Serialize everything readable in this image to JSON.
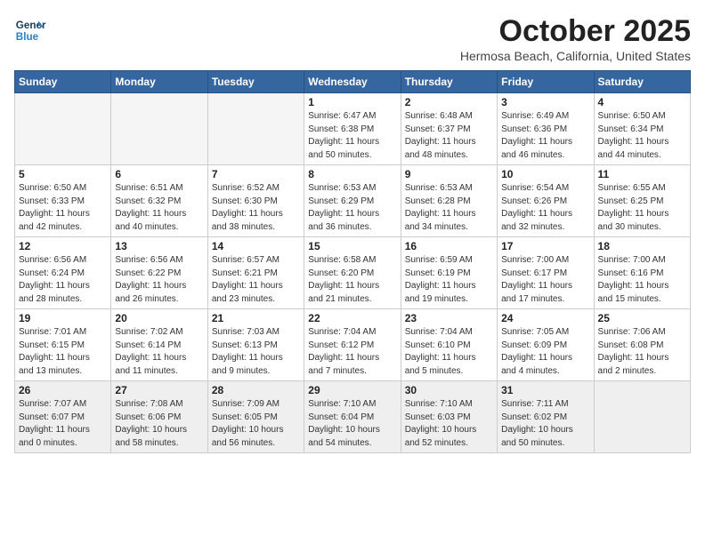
{
  "logo": {
    "line1": "General",
    "line2": "Blue"
  },
  "title": "October 2025",
  "location": "Hermosa Beach, California, United States",
  "weekdays": [
    "Sunday",
    "Monday",
    "Tuesday",
    "Wednesday",
    "Thursday",
    "Friday",
    "Saturday"
  ],
  "weeks": [
    [
      {
        "day": "",
        "info": ""
      },
      {
        "day": "",
        "info": ""
      },
      {
        "day": "",
        "info": ""
      },
      {
        "day": "1",
        "info": "Sunrise: 6:47 AM\nSunset: 6:38 PM\nDaylight: 11 hours\nand 50 minutes."
      },
      {
        "day": "2",
        "info": "Sunrise: 6:48 AM\nSunset: 6:37 PM\nDaylight: 11 hours\nand 48 minutes."
      },
      {
        "day": "3",
        "info": "Sunrise: 6:49 AM\nSunset: 6:36 PM\nDaylight: 11 hours\nand 46 minutes."
      },
      {
        "day": "4",
        "info": "Sunrise: 6:50 AM\nSunset: 6:34 PM\nDaylight: 11 hours\nand 44 minutes."
      }
    ],
    [
      {
        "day": "5",
        "info": "Sunrise: 6:50 AM\nSunset: 6:33 PM\nDaylight: 11 hours\nand 42 minutes."
      },
      {
        "day": "6",
        "info": "Sunrise: 6:51 AM\nSunset: 6:32 PM\nDaylight: 11 hours\nand 40 minutes."
      },
      {
        "day": "7",
        "info": "Sunrise: 6:52 AM\nSunset: 6:30 PM\nDaylight: 11 hours\nand 38 minutes."
      },
      {
        "day": "8",
        "info": "Sunrise: 6:53 AM\nSunset: 6:29 PM\nDaylight: 11 hours\nand 36 minutes."
      },
      {
        "day": "9",
        "info": "Sunrise: 6:53 AM\nSunset: 6:28 PM\nDaylight: 11 hours\nand 34 minutes."
      },
      {
        "day": "10",
        "info": "Sunrise: 6:54 AM\nSunset: 6:26 PM\nDaylight: 11 hours\nand 32 minutes."
      },
      {
        "day": "11",
        "info": "Sunrise: 6:55 AM\nSunset: 6:25 PM\nDaylight: 11 hours\nand 30 minutes."
      }
    ],
    [
      {
        "day": "12",
        "info": "Sunrise: 6:56 AM\nSunset: 6:24 PM\nDaylight: 11 hours\nand 28 minutes."
      },
      {
        "day": "13",
        "info": "Sunrise: 6:56 AM\nSunset: 6:22 PM\nDaylight: 11 hours\nand 26 minutes."
      },
      {
        "day": "14",
        "info": "Sunrise: 6:57 AM\nSunset: 6:21 PM\nDaylight: 11 hours\nand 23 minutes."
      },
      {
        "day": "15",
        "info": "Sunrise: 6:58 AM\nSunset: 6:20 PM\nDaylight: 11 hours\nand 21 minutes."
      },
      {
        "day": "16",
        "info": "Sunrise: 6:59 AM\nSunset: 6:19 PM\nDaylight: 11 hours\nand 19 minutes."
      },
      {
        "day": "17",
        "info": "Sunrise: 7:00 AM\nSunset: 6:17 PM\nDaylight: 11 hours\nand 17 minutes."
      },
      {
        "day": "18",
        "info": "Sunrise: 7:00 AM\nSunset: 6:16 PM\nDaylight: 11 hours\nand 15 minutes."
      }
    ],
    [
      {
        "day": "19",
        "info": "Sunrise: 7:01 AM\nSunset: 6:15 PM\nDaylight: 11 hours\nand 13 minutes."
      },
      {
        "day": "20",
        "info": "Sunrise: 7:02 AM\nSunset: 6:14 PM\nDaylight: 11 hours\nand 11 minutes."
      },
      {
        "day": "21",
        "info": "Sunrise: 7:03 AM\nSunset: 6:13 PM\nDaylight: 11 hours\nand 9 minutes."
      },
      {
        "day": "22",
        "info": "Sunrise: 7:04 AM\nSunset: 6:12 PM\nDaylight: 11 hours\nand 7 minutes."
      },
      {
        "day": "23",
        "info": "Sunrise: 7:04 AM\nSunset: 6:10 PM\nDaylight: 11 hours\nand 5 minutes."
      },
      {
        "day": "24",
        "info": "Sunrise: 7:05 AM\nSunset: 6:09 PM\nDaylight: 11 hours\nand 4 minutes."
      },
      {
        "day": "25",
        "info": "Sunrise: 7:06 AM\nSunset: 6:08 PM\nDaylight: 11 hours\nand 2 minutes."
      }
    ],
    [
      {
        "day": "26",
        "info": "Sunrise: 7:07 AM\nSunset: 6:07 PM\nDaylight: 11 hours\nand 0 minutes."
      },
      {
        "day": "27",
        "info": "Sunrise: 7:08 AM\nSunset: 6:06 PM\nDaylight: 10 hours\nand 58 minutes."
      },
      {
        "day": "28",
        "info": "Sunrise: 7:09 AM\nSunset: 6:05 PM\nDaylight: 10 hours\nand 56 minutes."
      },
      {
        "day": "29",
        "info": "Sunrise: 7:10 AM\nSunset: 6:04 PM\nDaylight: 10 hours\nand 54 minutes."
      },
      {
        "day": "30",
        "info": "Sunrise: 7:10 AM\nSunset: 6:03 PM\nDaylight: 10 hours\nand 52 minutes."
      },
      {
        "day": "31",
        "info": "Sunrise: 7:11 AM\nSunset: 6:02 PM\nDaylight: 10 hours\nand 50 minutes."
      },
      {
        "day": "",
        "info": ""
      }
    ]
  ]
}
